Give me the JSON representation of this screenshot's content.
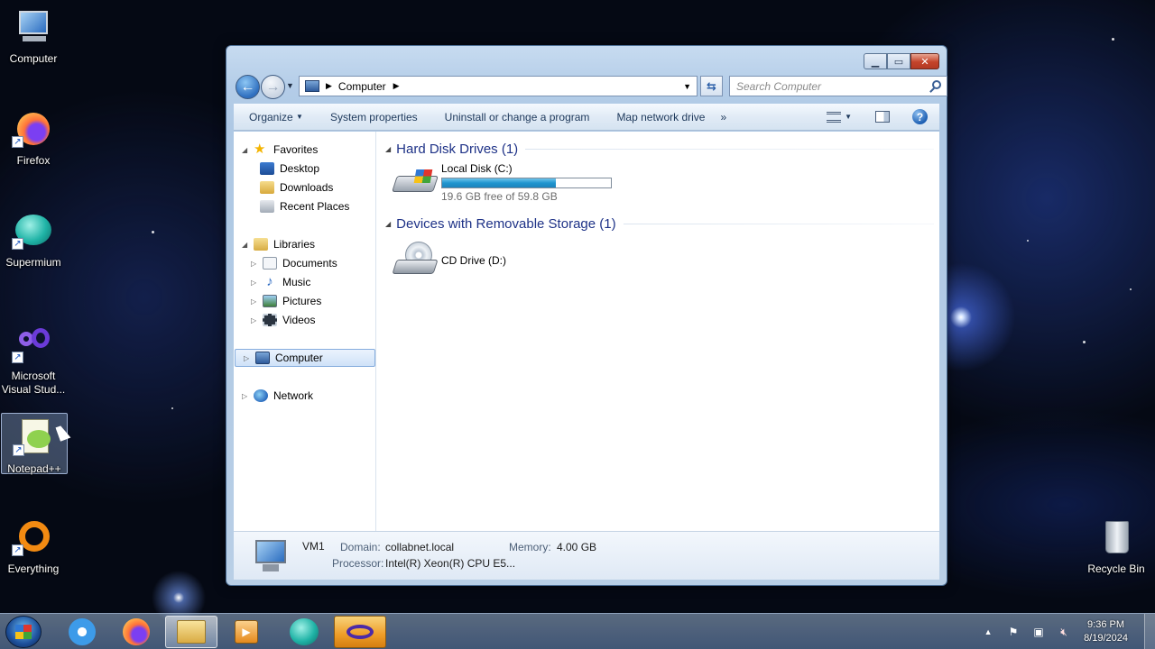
{
  "desktop": {
    "icons": [
      {
        "label": "Computer"
      },
      {
        "label": "Firefox"
      },
      {
        "label": "Supermium"
      },
      {
        "label": "Microsoft Visual Stud..."
      },
      {
        "label": "Notepad++"
      },
      {
        "label": "Everything"
      },
      {
        "label": "Recycle Bin"
      }
    ]
  },
  "window": {
    "address": {
      "path": "Computer"
    },
    "search": {
      "placeholder": "Search Computer"
    },
    "toolbar": {
      "organize": "Organize",
      "system_properties": "System properties",
      "uninstall": "Uninstall or change a program",
      "map_network": "Map network drive",
      "more": "»"
    },
    "nav": {
      "favorites": "Favorites",
      "desktop": "Desktop",
      "downloads": "Downloads",
      "recent": "Recent Places",
      "libraries": "Libraries",
      "documents": "Documents",
      "music": "Music",
      "pictures": "Pictures",
      "videos": "Videos",
      "computer": "Computer",
      "network": "Network"
    },
    "groups": {
      "hdd": "Hard Disk Drives (1)",
      "removable": "Devices with Removable Storage (1)"
    },
    "drives": {
      "c_name": "Local Disk (C:)",
      "c_free": "19.6 GB free of 59.8 GB",
      "c_used_fraction": 0.672,
      "d_name": "CD Drive (D:)"
    },
    "details": {
      "name": "VM1",
      "domain_label": "Domain:",
      "domain": "collabnet.local",
      "memory_label": "Memory:",
      "memory": "4.00 GB",
      "processor_label": "Processor:",
      "processor": "Intel(R) Xeon(R) CPU E5..."
    }
  },
  "taskbar": {
    "time": "9:36 PM",
    "date": "8/19/2024"
  },
  "colors": {
    "accent": "#1e3287",
    "bar_fill": "#1f95cf"
  }
}
